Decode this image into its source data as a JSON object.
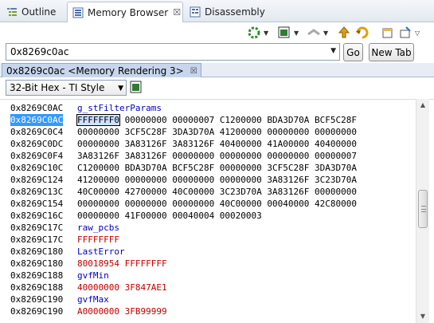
{
  "tabs": [
    {
      "label": "Outline",
      "icon": "outline-icon"
    },
    {
      "label": "Memory Browser",
      "icon": "memory-browser-icon",
      "close": "☒"
    },
    {
      "label": "Disassembly",
      "icon": "disassembly-icon"
    }
  ],
  "address": {
    "value": "0x8269c0ac",
    "go_label": "Go",
    "new_tab_label": "New Tab"
  },
  "rendering_tab": {
    "label": "0x8269c0ac <Memory Rendering 3>",
    "close": "☒"
  },
  "format": {
    "selected": "32-Bit Hex - TI Style"
  },
  "colors": {
    "symbol": "#0000c0",
    "changed": "#c00000",
    "selection": "#3399ff"
  },
  "memory_rows": [
    {
      "addr": "0x8269C0AC",
      "symbol": "g_stFilterParams"
    },
    {
      "addr": "0x8269C0AC",
      "first": "FFFFFFF0",
      "rest": " 00000000 00000007 C1200000 BDA3D70A BCF5C28F",
      "selected": true
    },
    {
      "addr": "0x8269C0C4",
      "data": "00000000 3CF5C28F 3DA3D70A 41200000 00000000 00000000"
    },
    {
      "addr": "0x8269C0DC",
      "data": "00000000 3A83126F 3A83126F 40400000 41A00000 40400000"
    },
    {
      "addr": "0x8269C0F4",
      "data": "3A83126F 3A83126F 00000000 00000000 00000000 00000007"
    },
    {
      "addr": "0x8269C10C",
      "data": "C1200000 BDA3D70A BCF5C28F 00000000 3CF5C28F 3DA3D70A"
    },
    {
      "addr": "0x8269C124",
      "data": "41200000 00000000 00000000 00000000 3A83126F 3C23D70A"
    },
    {
      "addr": "0x8269C13C",
      "data": "40C00000 42700000 40C00000 3C23D70A 3A83126F 00000000"
    },
    {
      "addr": "0x8269C154",
      "data": "00000000 00000000 00000000 40C00000 00040000 42C80000"
    },
    {
      "addr": "0x8269C16C",
      "data": "00000000 41F00000 00040004 00020003"
    },
    {
      "addr": "0x8269C17C",
      "symbol": "raw_pcbs"
    },
    {
      "addr": "0x8269C17C",
      "red": "FFFFFFFF"
    },
    {
      "addr": "0x8269C180",
      "symbol": "LastError"
    },
    {
      "addr": "0x8269C180",
      "red": "80018954 FFFFFFFF"
    },
    {
      "addr": "0x8269C188",
      "symbol": "gvfMin"
    },
    {
      "addr": "0x8269C188",
      "red": "40000000 3F847AE1"
    },
    {
      "addr": "0x8269C190",
      "symbol": "gvfMax"
    },
    {
      "addr": "0x8269C190",
      "red": "A0000000 3FB99999"
    }
  ]
}
